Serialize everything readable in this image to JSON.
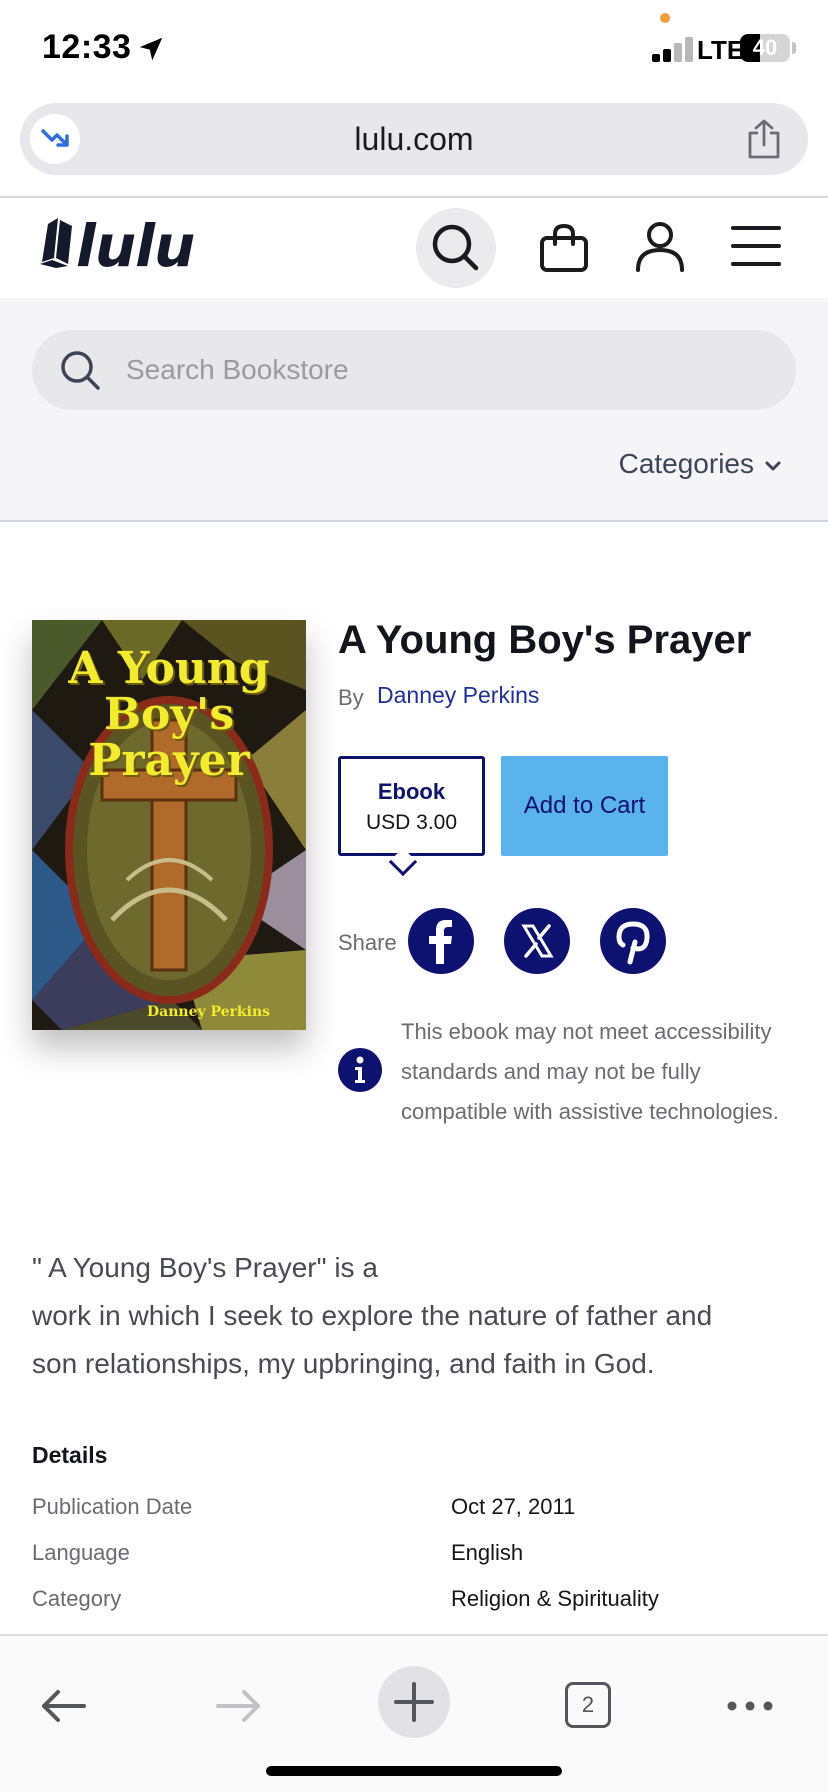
{
  "status_bar": {
    "time": "12:33",
    "network": "LTE",
    "battery": "40",
    "battery_level": 0.4
  },
  "browser": {
    "url": "lulu.com",
    "tab_count": "2"
  },
  "site": {
    "logo_text": "lulu"
  },
  "search": {
    "placeholder": "Search Bookstore",
    "categories_label": "Categories"
  },
  "product": {
    "title": "A Young Boy's Prayer",
    "by_label": "By",
    "author": "Danney Perkins",
    "cover_title_lines": [
      "A Young",
      "Boy's",
      "Prayer"
    ],
    "cover_author": "Danney Perkins",
    "format": {
      "name": "Ebook",
      "price": "USD 3.00"
    },
    "add_to_cart_label": "Add to Cart",
    "share_label": "Share",
    "share_icons": [
      "facebook-icon",
      "x-twitter-icon",
      "pinterest-icon"
    ],
    "accessibility_note": "This ebook may not meet accessibility standards and may not be fully compatible with assistive technologies.",
    "description_lines": [
      "\" A Young Boy's Prayer\" is a",
      "work in which I seek to explore the nature of father and",
      "son relationships, my upbringing, and faith in God."
    ]
  },
  "details": {
    "heading": "Details",
    "rows": [
      {
        "label": "Publication Date",
        "value": "Oct 27, 2011"
      },
      {
        "label": "Language",
        "value": "English"
      },
      {
        "label": "Category",
        "value": "Religion & Spirituality"
      }
    ]
  },
  "colors": {
    "brand_navy": "#0d1170",
    "cart_blue": "#5ab3ec",
    "link_blue": "#1f2fa0",
    "cover_yellow": "#f2ec2c"
  }
}
